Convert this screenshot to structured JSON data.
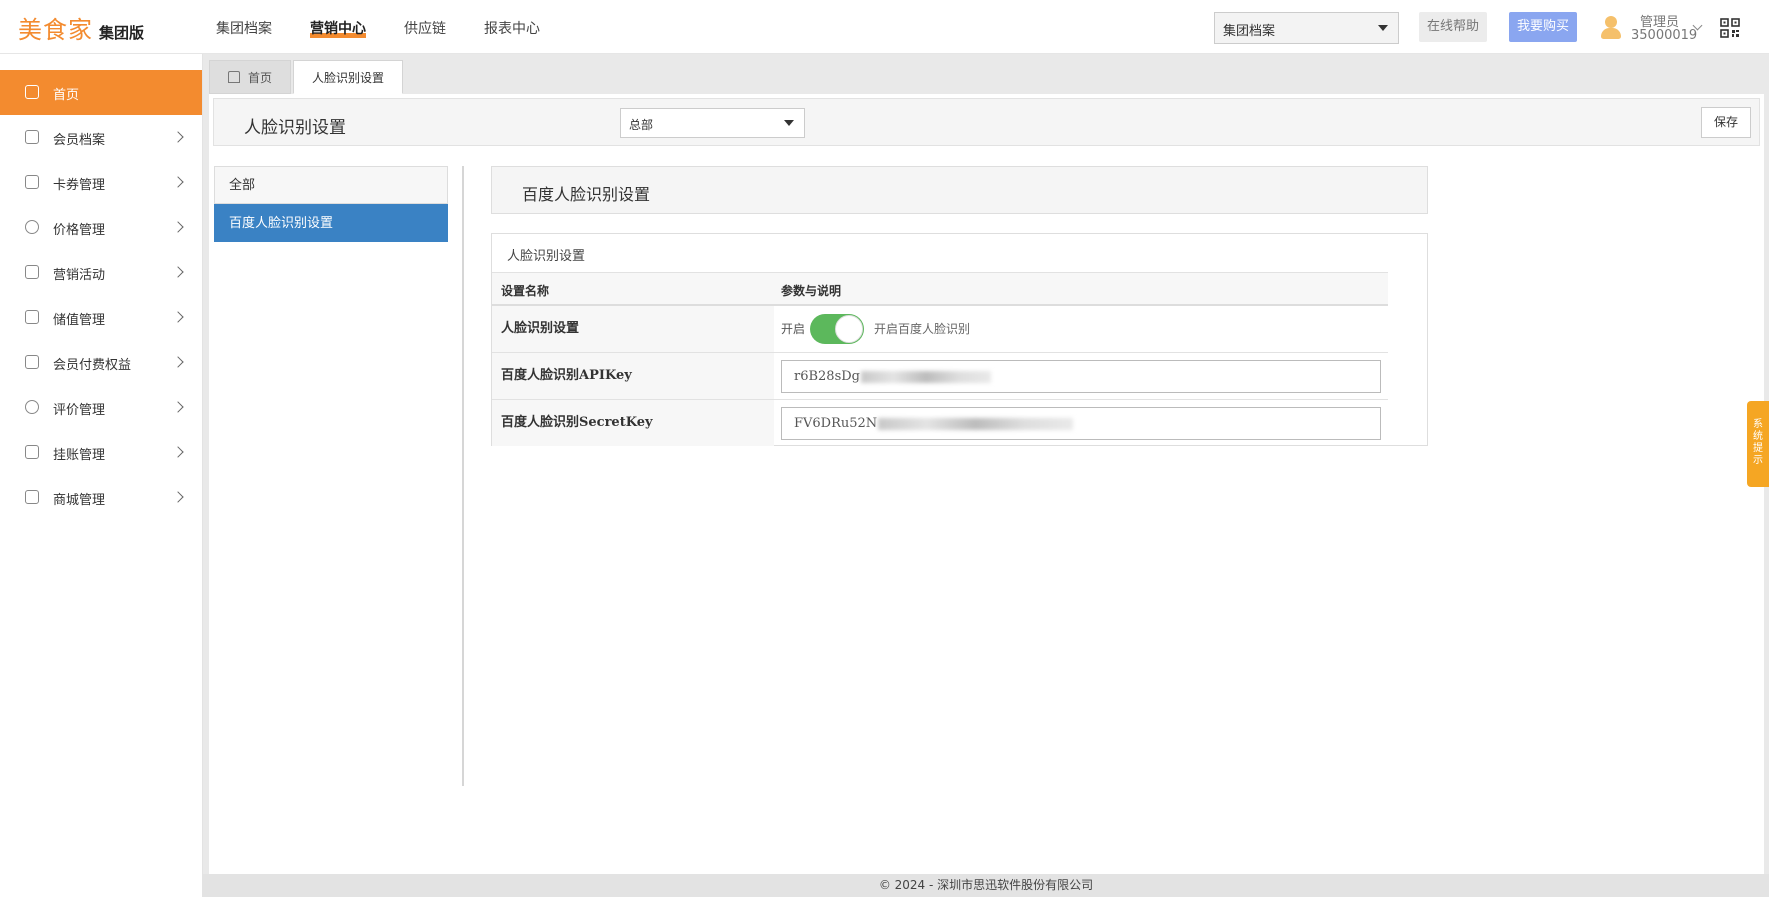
{
  "brand": {
    "logo": "美食家",
    "edition": "集团版"
  },
  "topnav": [
    {
      "label": "集团档案"
    },
    {
      "label": "营销中心"
    },
    {
      "label": "供应链"
    },
    {
      "label": "报表中心"
    }
  ],
  "header": {
    "archive_select": "集团档案",
    "help_label": "在线帮助",
    "buy_label": "我要购买",
    "user_role": "管理员",
    "user_id": "35000019"
  },
  "sidebar": {
    "items": [
      {
        "label": "首页",
        "icon": "home-icon"
      },
      {
        "label": "会员档案",
        "icon": "crown-icon"
      },
      {
        "label": "卡券管理",
        "icon": "coupon-icon"
      },
      {
        "label": "价格管理",
        "icon": "price-icon"
      },
      {
        "label": "营销活动",
        "icon": "chart-icon"
      },
      {
        "label": "储值管理",
        "icon": "wallet-icon"
      },
      {
        "label": "会员付费权益",
        "icon": "badge-icon"
      },
      {
        "label": "评价管理",
        "icon": "comment-icon"
      },
      {
        "label": "挂账管理",
        "icon": "ledger-icon"
      },
      {
        "label": "商城管理",
        "icon": "store-icon"
      }
    ]
  },
  "tabs": [
    {
      "label": "首页"
    },
    {
      "label": "人脸识别设置"
    }
  ],
  "page": {
    "title": "人脸识别设置",
    "store_select": "总部",
    "save_label": "保存"
  },
  "categories": [
    {
      "label": "全部"
    },
    {
      "label": "百度人脸识别设置"
    }
  ],
  "section": {
    "title": "百度人脸识别设置",
    "box_caption": "人脸识别设置",
    "col_name": "设置名称",
    "col_param": "参数与说明",
    "rows": [
      {
        "name": "人脸识别设置",
        "toggle_label": "开启",
        "toggle_on": true,
        "desc": "开启百度人脸识别"
      },
      {
        "name": "百度人脸识别APIKey",
        "value": "r6B28sDg"
      },
      {
        "name": "百度人脸识别SecretKey",
        "value": "FV6DRu52N"
      }
    ]
  },
  "footer": {
    "copyright": "© 2024 - 深圳市思迅软件股份有限公司"
  },
  "side_notice": {
    "label": "系统提示"
  },
  "colors": {
    "accent": "#f38b2f",
    "selected": "#3a82c4",
    "toggle": "#5cb85c",
    "buy": "#8aa6f0",
    "notice": "#f5a623"
  }
}
